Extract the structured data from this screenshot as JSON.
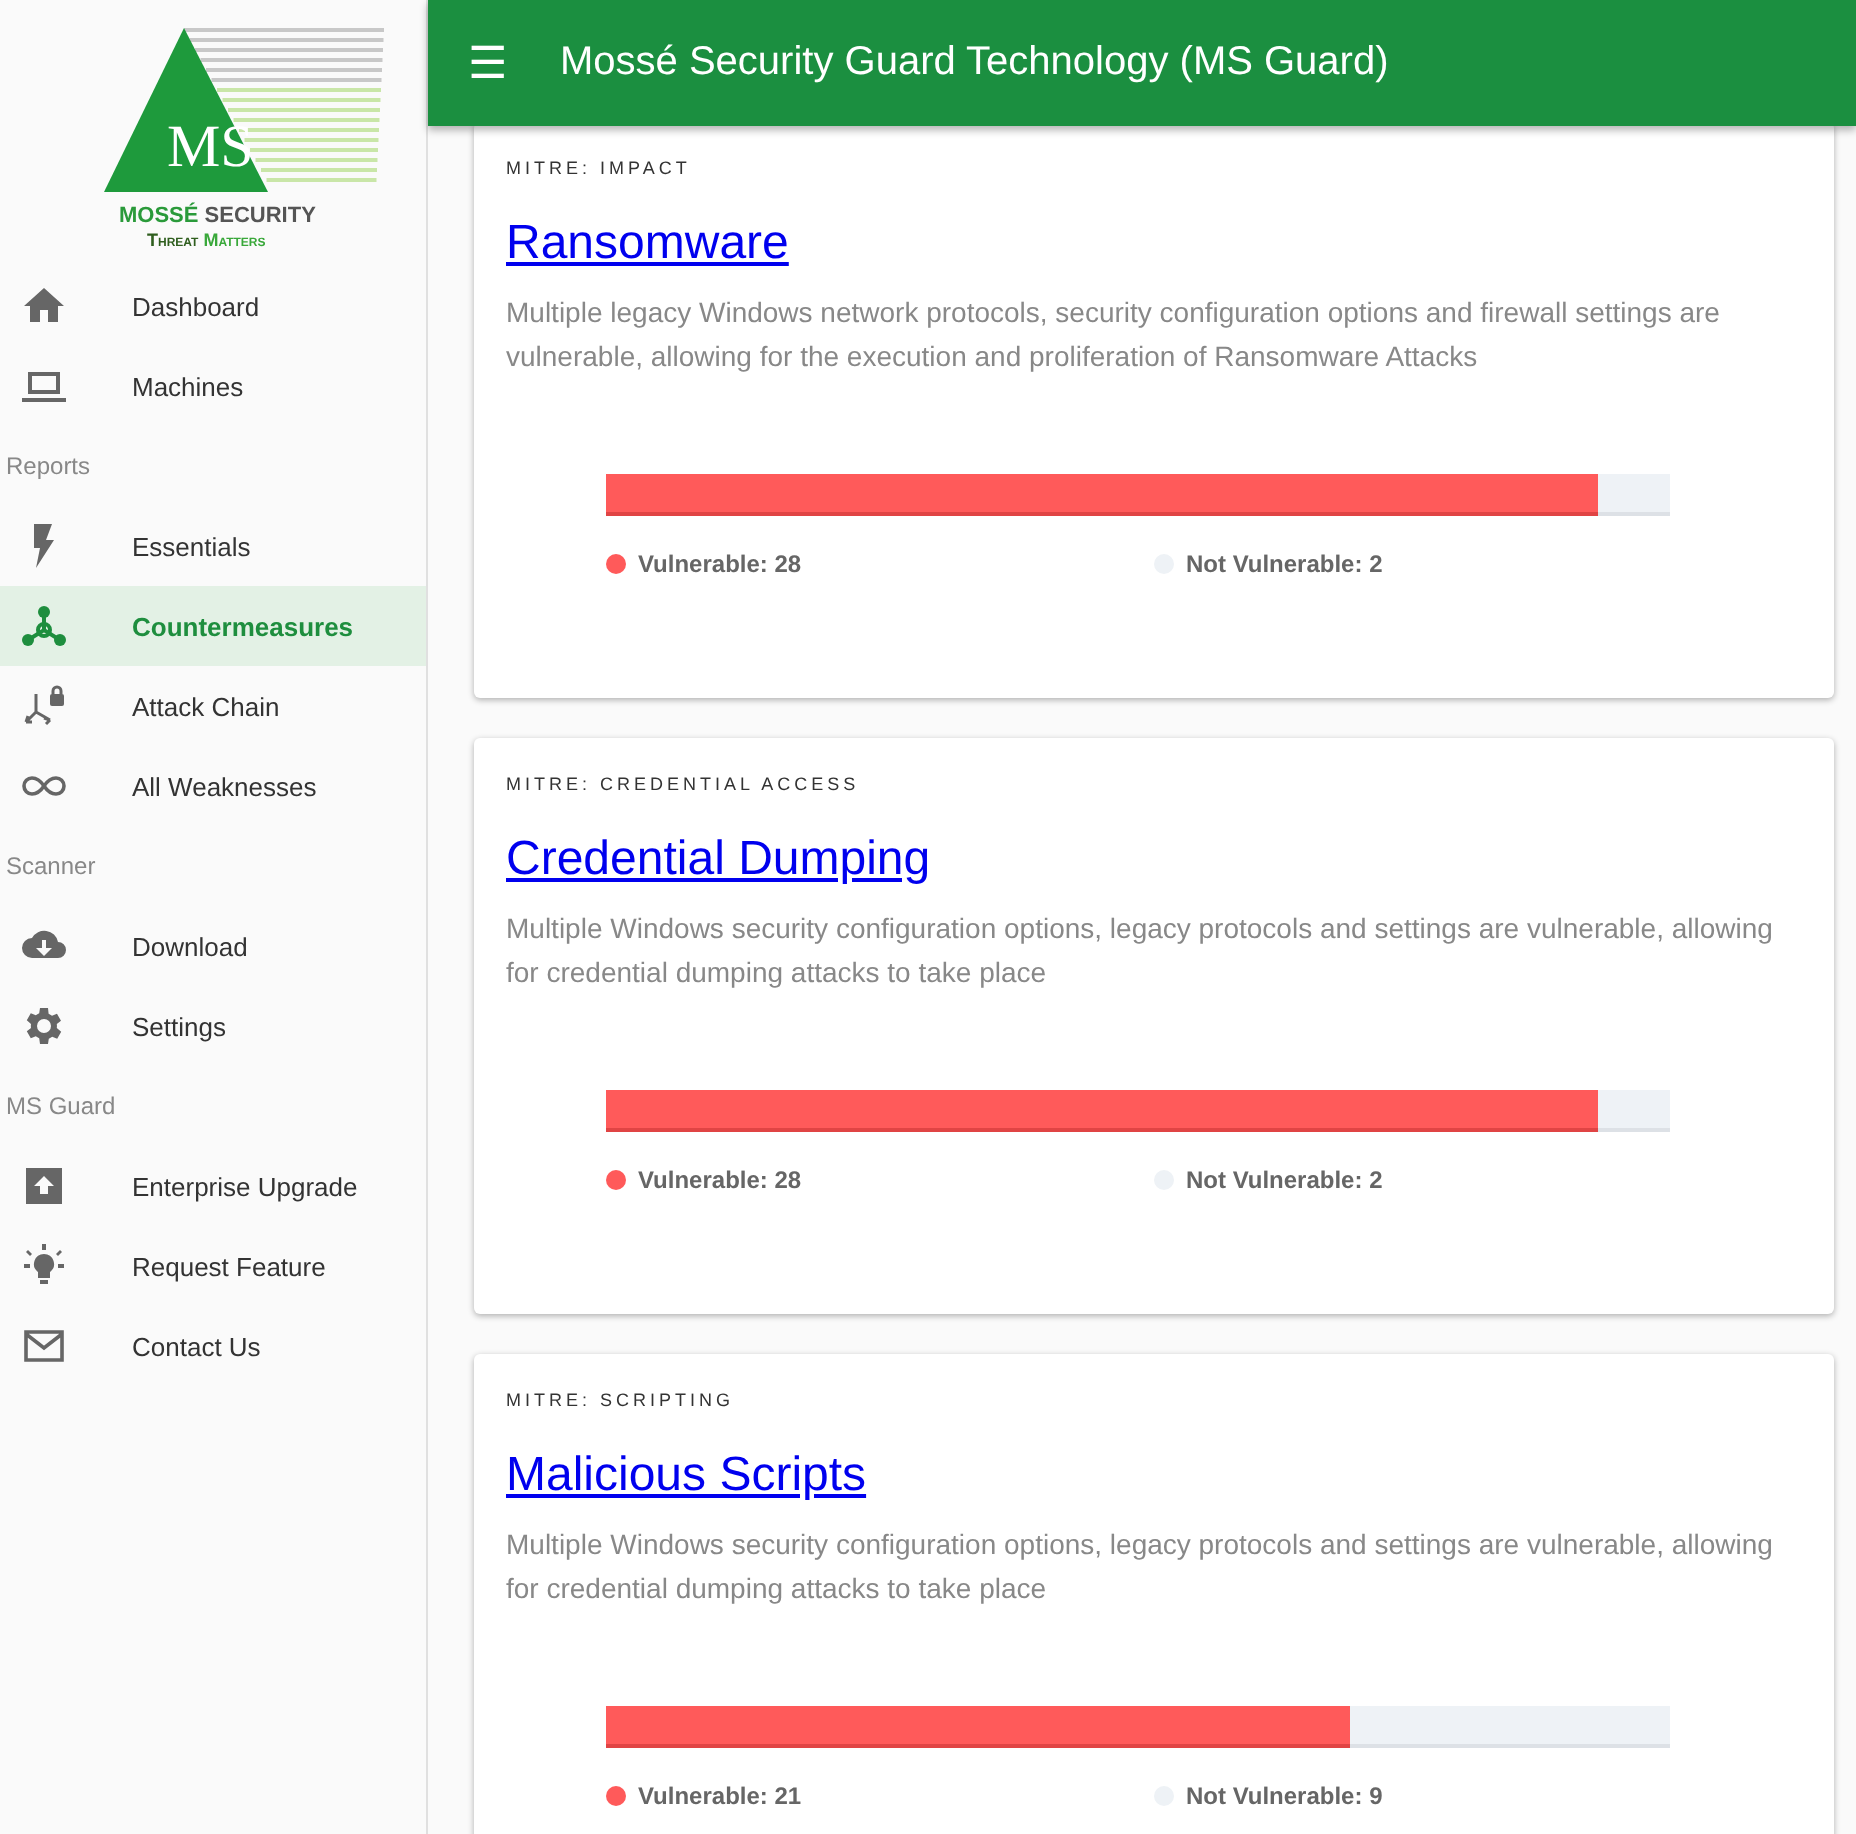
{
  "logo": {
    "initials": "MS",
    "name_part1": "MOSSÉ",
    "name_part2": "SECURITY",
    "tagline_part1": "Threat",
    "tagline_part2": "Matters"
  },
  "header": {
    "menu_icon": "☰",
    "title": "Mossé Security Guard Technology (MS Guard)"
  },
  "sidebar": [
    {
      "kind": "item",
      "label": "Dashboard",
      "selected": false
    },
    {
      "kind": "item",
      "label": "Machines",
      "selected": false
    },
    {
      "kind": "section",
      "label": "Reports"
    },
    {
      "kind": "item",
      "label": "Essentials",
      "selected": false
    },
    {
      "kind": "item",
      "label": "Countermeasures",
      "selected": true
    },
    {
      "kind": "item",
      "label": "Attack Chain",
      "selected": false
    },
    {
      "kind": "item",
      "label": "All Weaknesses",
      "selected": false
    },
    {
      "kind": "section",
      "label": "Scanner"
    },
    {
      "kind": "item",
      "label": "Download",
      "selected": false
    },
    {
      "kind": "item",
      "label": "Settings",
      "selected": false
    },
    {
      "kind": "section",
      "label": "MS Guard"
    },
    {
      "kind": "item",
      "label": "Enterprise Upgrade",
      "selected": false
    },
    {
      "kind": "item",
      "label": "Request Feature",
      "selected": false
    },
    {
      "kind": "item",
      "label": "Contact Us",
      "selected": false
    }
  ],
  "cards": [
    {
      "category": "MITRE: IMPACT",
      "title": "Ransomware",
      "description": "Multiple legacy Windows network protocols, security configuration options and firewall settings are vulnerable, allowing for the execution and proliferation of Ransomware Attacks",
      "level": 0.933,
      "legend": [
        {
          "label": "Vulnerable: 28",
          "color": "#ff5a5a"
        },
        {
          "label": "Not Vulnerable: 2",
          "color": "#eef2f6"
        }
      ]
    },
    {
      "category": "MITRE: CREDENTIAL ACCESS",
      "title": "Credential Dumping",
      "description": "Multiple Windows security configuration options, legacy protocols and settings are vulnerable, allowing for credential dumping attacks to take place",
      "level": 0.933,
      "legend": [
        {
          "label": "Vulnerable: 28",
          "color": "#ff5a5a"
        },
        {
          "label": "Not Vulnerable: 2",
          "color": "#eef2f6"
        }
      ]
    },
    {
      "category": "MITRE: SCRIPTING",
      "title": "Malicious Scripts",
      "description": "Multiple Windows security configuration options, legacy protocols and settings are vulnerable, allowing for credential dumping attacks to take place",
      "level": 0.7,
      "legend": [
        {
          "label": "Vulnerable: 21",
          "color": "#ff5a5a"
        },
        {
          "label": "Not Vulnerable: 9",
          "color": "#eef2f6"
        }
      ]
    }
  ]
}
